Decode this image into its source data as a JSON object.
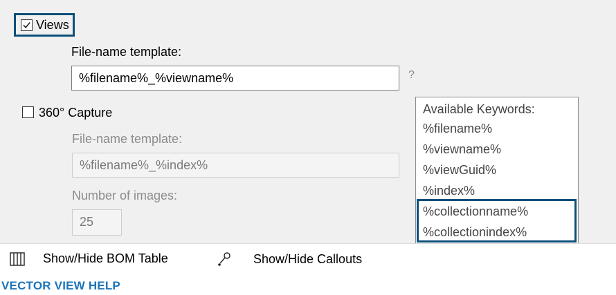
{
  "views": {
    "checked": true,
    "label": "Views",
    "template_label": "File-name template:",
    "template_value": "%filename%_%viewname%",
    "help": "?"
  },
  "capture360": {
    "checked": false,
    "label": "360° Capture",
    "template_label": "File-name template:",
    "template_value": "%filename%_%index%",
    "count_label": "Number of images:",
    "count_value": "25"
  },
  "keywords": {
    "title": "Available Keywords:",
    "items": [
      "%filename%",
      "%viewname%",
      "%viewGuid%",
      "%index%",
      "%collectionname%",
      "%collectionindex%"
    ]
  },
  "toolbar": {
    "bom_label": "Show/Hide BOM Table",
    "callouts_label": "Show/Hide Callouts"
  },
  "help_link": "VECTOR VIEW HELP",
  "colors": {
    "highlight": "#0b4f79",
    "link": "#1b75bb",
    "panel": "#f0f0f0"
  }
}
